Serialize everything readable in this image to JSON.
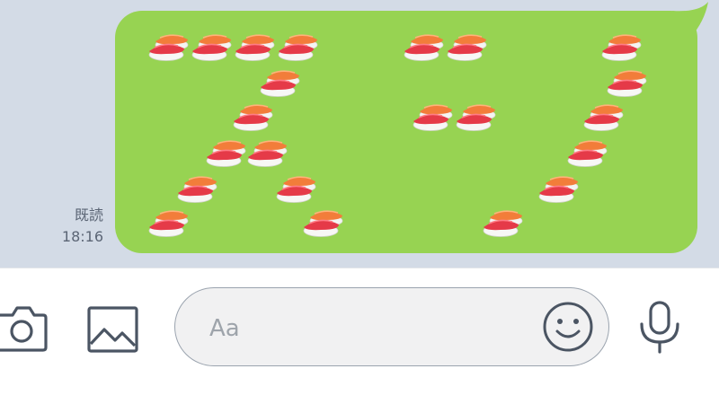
{
  "chat": {
    "read_label": "既読",
    "timestamp": "18:16",
    "bubble_color": "#97d352",
    "background_color": "#d3dbe6",
    "message_content": "sushi-emoji-pattern"
  },
  "composer": {
    "placeholder": "Aa",
    "value": "",
    "icons": [
      "camera-icon",
      "image-icon",
      "emoji-icon",
      "microphone-icon"
    ],
    "icon_color": "#4b5563"
  }
}
